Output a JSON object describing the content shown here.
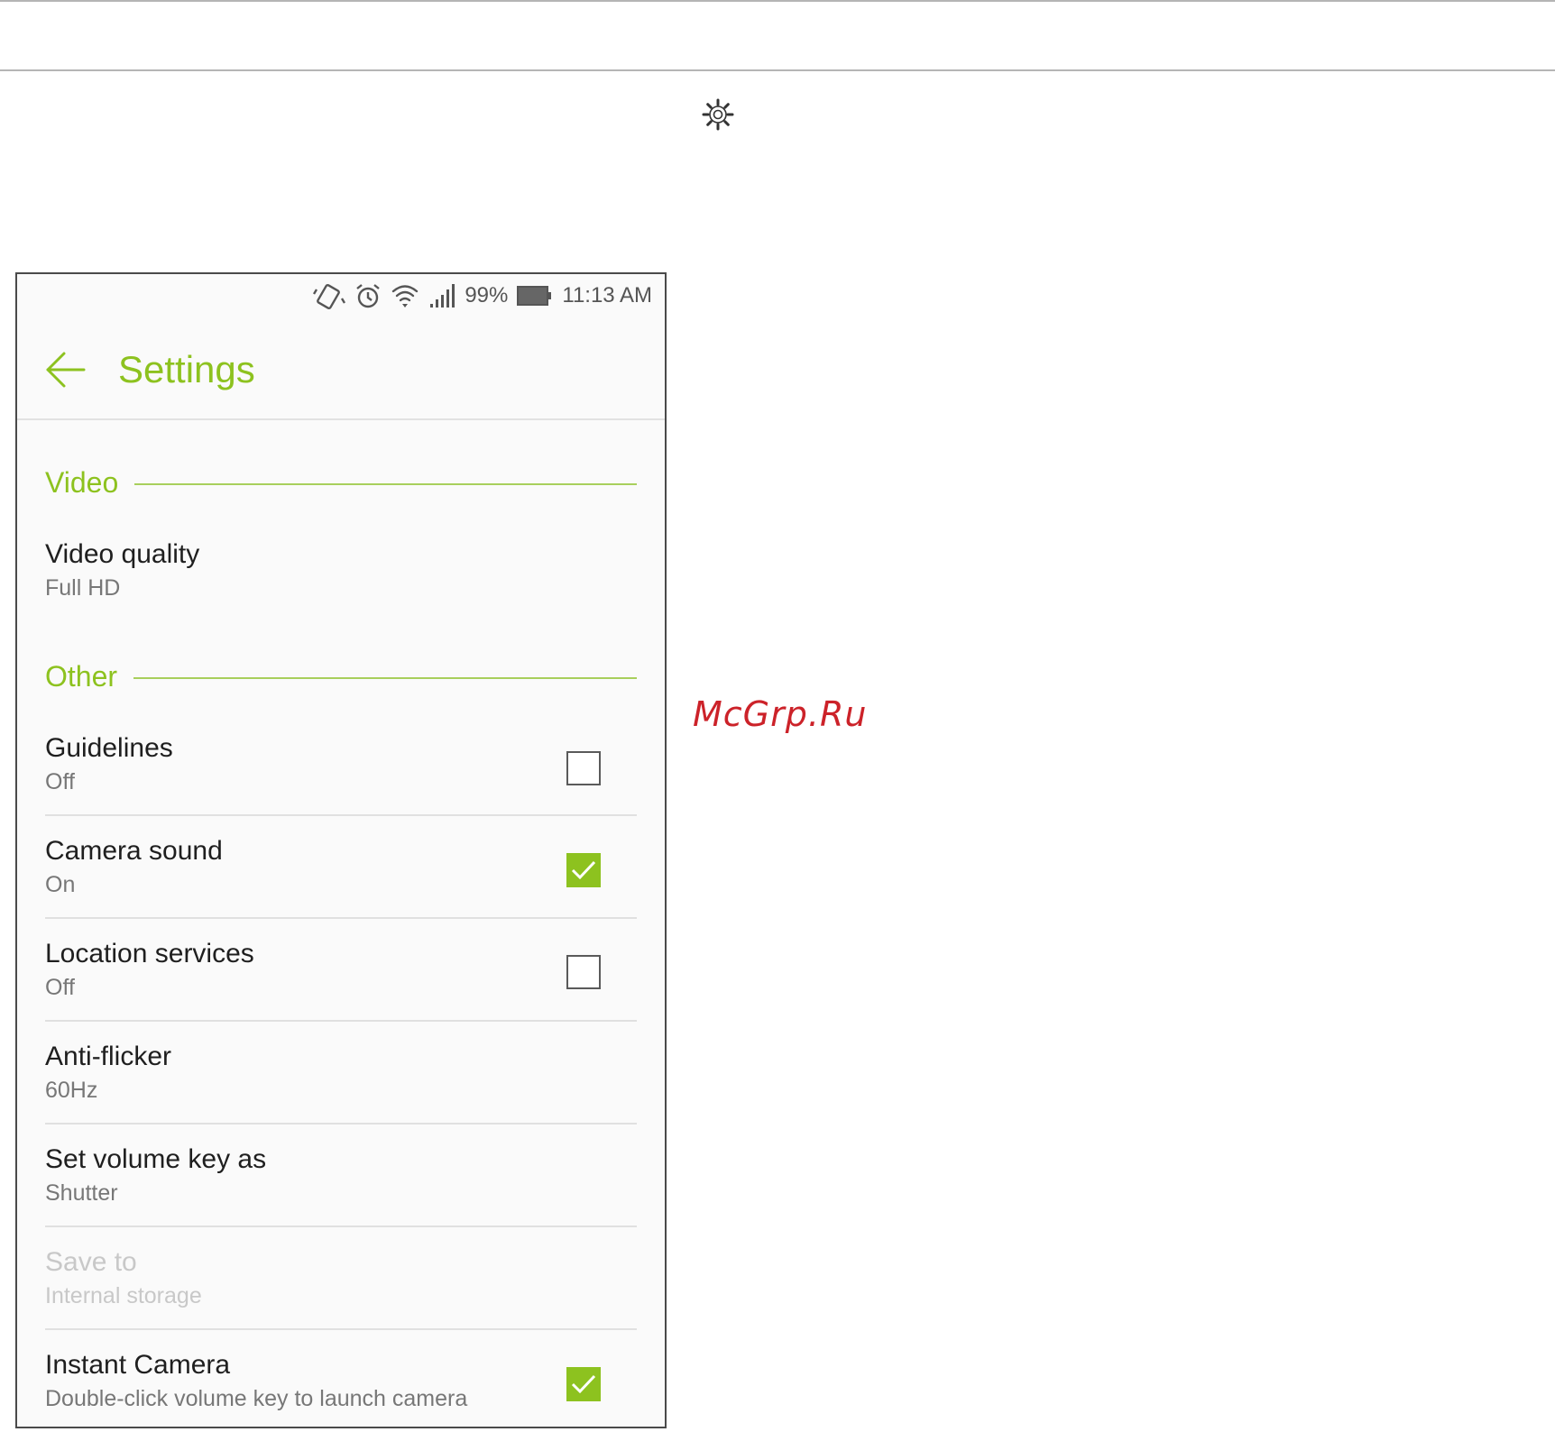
{
  "status_bar": {
    "battery_percent": "99%",
    "time": "11:13 AM"
  },
  "app_bar": {
    "title": "Settings"
  },
  "sections": {
    "video": {
      "header": "Video"
    },
    "other": {
      "header": "Other"
    }
  },
  "items": {
    "video_quality": {
      "title": "Video quality",
      "value": "Full HD"
    },
    "guidelines": {
      "title": "Guidelines",
      "value": "Off",
      "checked": false
    },
    "camera_sound": {
      "title": "Camera sound",
      "value": "On",
      "checked": true
    },
    "location_services": {
      "title": "Location services",
      "value": "Off",
      "checked": false
    },
    "anti_flicker": {
      "title": "Anti-flicker",
      "value": "60Hz"
    },
    "volume_key": {
      "title": "Set volume key as",
      "value": "Shutter"
    },
    "save_to": {
      "title": "Save to",
      "value": "Internal storage",
      "enabled": false
    },
    "instant_camera": {
      "title": "Instant Camera",
      "value": "Double-click volume key to launch camera",
      "checked": true
    }
  },
  "watermark": "McGrp.Ru",
  "colors": {
    "accent": "#8dc21f",
    "watermark": "#cc2229"
  }
}
